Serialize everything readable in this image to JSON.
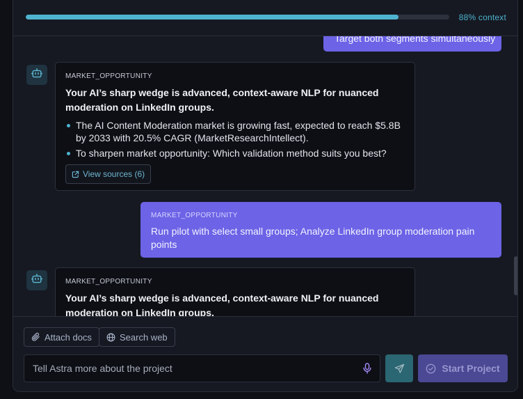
{
  "context": {
    "percent": 88,
    "label": "88% context"
  },
  "messages": [
    {
      "role": "user",
      "text": "Target both segments simultaneously"
    },
    {
      "role": "bot",
      "tag": "MARKET_OPPORTUNITY",
      "heading": "Your AI’s sharp wedge is advanced, context-aware NLP for nuanced moderation on LinkedIn groups.",
      "bullets": [
        "The AI Content Moderation market is growing fast, expected to reach $5.8B by 2033 with 20.5% CAGR (MarketResearchIntellect).",
        "To sharpen market opportunity: Which validation method suits you best?"
      ],
      "sources_label": "View sources (6)"
    },
    {
      "role": "user",
      "tag": "MARKET_OPPORTUNITY",
      "text": "Run pilot with select small groups; Analyze LinkedIn group moderation pain points"
    },
    {
      "role": "bot",
      "tag": "MARKET_OPPORTUNITY",
      "heading": "Your AI’s sharp wedge is advanced, context-aware NLP for nuanced moderation on LinkedIn groups."
    }
  ],
  "composer": {
    "attach_label": "Attach docs",
    "search_label": "Search web",
    "placeholder": "Tell Astra more about the project",
    "start_label": "Start Project"
  },
  "icons": {
    "bot": "robot-icon",
    "external": "external-link-icon",
    "attach": "paperclip-icon",
    "search": "globe-icon",
    "mic": "microphone-icon",
    "send": "send-icon",
    "start": "check-circle-icon"
  },
  "colors": {
    "accent": "#4eb3cf",
    "user_bubble": "#6c63e6",
    "start_button": "#4b4894",
    "send_button": "#2b6673"
  }
}
